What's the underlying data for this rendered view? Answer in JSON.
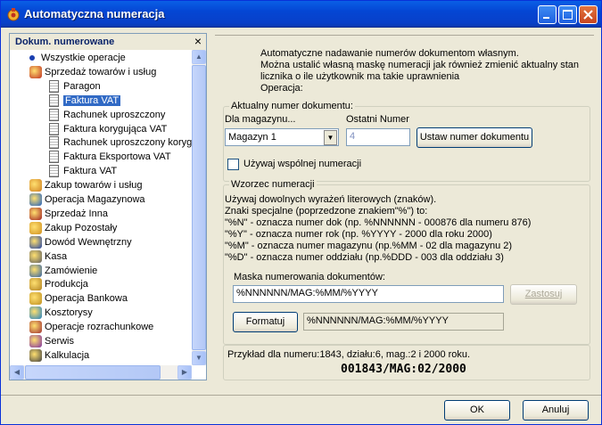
{
  "window": {
    "title": "Automatyczna numeracja"
  },
  "left_panel": {
    "title": "Dokum. numerowane",
    "close_glyph": "×",
    "tree": [
      {
        "label": "Wszystkie operacje",
        "icon": "bullet"
      },
      {
        "label": "Sprzedaż towarów i usług",
        "icon": "sales-icon"
      },
      {
        "label": "Paragon",
        "icon": "document-icon"
      },
      {
        "label": "Faktura VAT",
        "icon": "document-icon",
        "selected": true
      },
      {
        "label": "Rachunek uproszczony",
        "icon": "document-icon"
      },
      {
        "label": "Faktura korygująca VAT",
        "icon": "document-icon"
      },
      {
        "label": "Rachunek uproszczony koryg",
        "icon": "document-icon"
      },
      {
        "label": "Faktura Eksportowa VAT",
        "icon": "document-icon"
      },
      {
        "label": "Faktura VAT",
        "icon": "document-icon"
      },
      {
        "label": "Zakup towarów i usług",
        "icon": "purchase-icon"
      },
      {
        "label": "Operacja Magazynowa",
        "icon": "warehouse-icon"
      },
      {
        "label": "Sprzedaż Inna",
        "icon": "sales-other-icon"
      },
      {
        "label": "Zakup Pozostały",
        "icon": "purchase-other-icon"
      },
      {
        "label": "Dowód Wewnętrzny",
        "icon": "internal-doc-icon"
      },
      {
        "label": "Kasa",
        "icon": "cash-icon"
      },
      {
        "label": "Zamówienie",
        "icon": "order-icon"
      },
      {
        "label": "Produkcja",
        "icon": "production-icon"
      },
      {
        "label": "Operacja Bankowa",
        "icon": "bank-icon"
      },
      {
        "label": "Kosztorysy",
        "icon": "chart-icon"
      },
      {
        "label": "Operacje rozrachunkowe",
        "icon": "settlement-icon"
      },
      {
        "label": "Serwis",
        "icon": "service-icon"
      },
      {
        "label": "Kalkulacja",
        "icon": "calculator-icon"
      }
    ]
  },
  "intro": {
    "line1": "Automatyczne nadawanie numerów dokumentom własnym.",
    "line2": "Można ustalić własną maskę numeracji jak również zmienić aktualny stan",
    "line3": "licznika o ile użytkownik ma takie uprawnienia",
    "line4": "Operacja:"
  },
  "current": {
    "group_label": "Aktualny numer dokumentu:",
    "warehouse_label": "Dla magazynu...",
    "last_label": "Ostatni Numer",
    "warehouse_value": "Magazyn 1",
    "last_value": "4",
    "set_button": "Ustaw numer dokumentu",
    "common_checkbox": "Używaj wspólnej numeracji"
  },
  "pattern": {
    "group_label": "Wzorzec numeracji",
    "desc1": "Używaj dowolnych wyrażeń literowych (znaków).",
    "desc2": "Znaki specjalne (poprzedzone znakiem\"%\") to:",
    "desc3": "\"%N\" - oznacza numer dok (np. %NNNNNN - 000876 dla numeru 876)",
    "desc4": "\"%Y\" - oznacza numer rok (np. %YYYY - 2000 dla roku 2000)",
    "desc5": "\"%M\" - oznacza numer magazynu (np.%MM - 02 dla magazynu 2)",
    "desc6": "\"%D\" - oznacza numer oddziału (np.%DDD - 003 dla oddziału 3)",
    "mask_label": "Maska numerowania dokumentów:",
    "mask_value": "%NNNNNN/MAG:%MM/%YYYY",
    "apply_button": "Zastosuj",
    "format_button": "Formatuj",
    "formatted_value": "%NNNNNN/MAG:%MM/%YYYY"
  },
  "example": {
    "line1": "Przykład dla numeru:1843, działu:6, mag.:2 i 2000 roku.",
    "result": "001843/MAG:02/2000"
  },
  "footer": {
    "ok": "OK",
    "cancel": "Anuluj"
  },
  "colors": {
    "title_bar": "#0a5fe6",
    "selection": "#316ac5",
    "header_text": "#0a246a"
  }
}
